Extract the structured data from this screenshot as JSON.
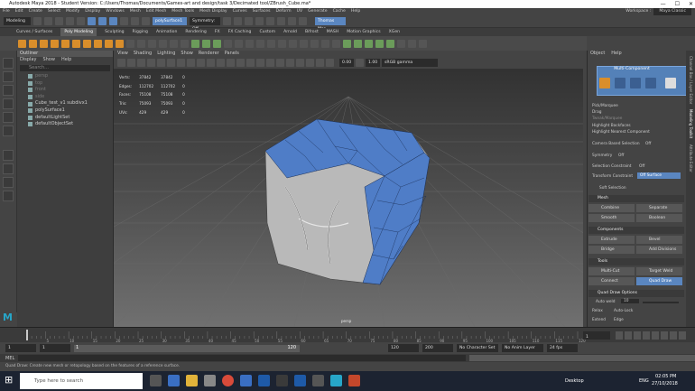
{
  "window": {
    "title": "Autodesk Maya 2018 - Student Version: C:/Users/Thomas/Documents/Games-art and design/task 3/Decimated tool/ZBrush_Cube.ma*",
    "minimize": "—",
    "maximize": "☐",
    "close": "✕"
  },
  "menubar": [
    "File",
    "Edit",
    "Create",
    "Select",
    "Modify",
    "Display",
    "Windows",
    "Mesh",
    "Edit Mesh",
    "Mesh Tools",
    "Mesh Display",
    "Curves",
    "Surfaces",
    "Deform",
    "UV",
    "Generate",
    "Cache",
    "Help"
  ],
  "workspace": {
    "label": "Workspace :",
    "value": "Maya Classic"
  },
  "statusline": {
    "mode": "Modeling",
    "symmetry": "Symmetry: Off",
    "user": "Thomas Mar",
    "object_field": "polySurface1"
  },
  "shelf_tabs": [
    "Curves / Surfaces",
    "Poly Modeling",
    "Sculpting",
    "Rigging",
    "Animation",
    "Rendering",
    "FX",
    "FX Caching",
    "Custom",
    "Arnold",
    "Bifrost",
    "MASH",
    "Motion Graphics",
    "XGen"
  ],
  "shelf_active": "Poly Modeling",
  "outliner": {
    "title": "Outliner",
    "menus": [
      "Display",
      "Show",
      "Help"
    ],
    "search_placeholder": "Search...",
    "items": [
      {
        "label": "persp",
        "dim": true
      },
      {
        "label": "top",
        "dim": true
      },
      {
        "label": "front",
        "dim": true
      },
      {
        "label": "side",
        "dim": true
      },
      {
        "label": "Cube_test_v1 subdivx1",
        "dim": false
      },
      {
        "label": "polySurface1",
        "dim": false
      },
      {
        "label": "defaultLightSet",
        "dim": false
      },
      {
        "label": "defaultObjectSet",
        "dim": false
      }
    ]
  },
  "viewport": {
    "menus": [
      "View",
      "Shading",
      "Lighting",
      "Show",
      "Renderer",
      "Panels"
    ],
    "camera": "persp",
    "gamma": "sRGB gamma",
    "exposure": "0.00",
    "gamma_value": "1.00",
    "hud": [
      {
        "label": "Verts:",
        "a": "37842",
        "b": "37842",
        "c": "0"
      },
      {
        "label": "Edges:",
        "a": "112702",
        "b": "112702",
        "c": "0"
      },
      {
        "label": "Faces:",
        "a": "75108",
        "b": "75108",
        "c": "0"
      },
      {
        "label": "Tris:",
        "a": "75093",
        "b": "75093",
        "c": "0"
      },
      {
        "label": "UVs:",
        "a": "429",
        "b": "429",
        "c": "0"
      }
    ]
  },
  "modeling_toolkit": {
    "menus": [
      "Object",
      "Help"
    ],
    "title": "Multi-Component",
    "pick_marquee": "Pick/Marquee",
    "drag": "Drag",
    "tweak_marquee": "Tweak/Marquee",
    "highlight_backfaces": "Highlight Backfaces",
    "highlight_nearest": "Highlight Nearest Component",
    "camera_based": "Camera Based Selection",
    "camera_based_value": "Off",
    "symmetry": "Symmetry",
    "symmetry_value": "Off",
    "selection_constraint": "Selection Constraint",
    "selection_constraint_value": "Off",
    "transform_constraint": "Transform Constraint",
    "transform_constraint_value": "Off Surface",
    "soft_selection": "Soft Selection",
    "mesh_section": "Mesh",
    "mesh_buttons": [
      "Combine",
      "Separate",
      "Smooth",
      "Boolean"
    ],
    "components_section": "Components",
    "component_buttons": [
      "Extrude",
      "Bevel",
      "Bridge",
      "Add Divisions"
    ],
    "tools_section": "Tools",
    "tool_buttons": [
      "Multi-Cut",
      "Target Weld",
      "Connect",
      "Quad Draw"
    ],
    "active_tool": "Quad Draw",
    "quad_draw_options": "Quad Draw Options",
    "auto_weld": "Auto weld",
    "auto_weld_value": "10",
    "relax": "Relax",
    "relax_value": "Auto-Lock",
    "extend": "Extend",
    "extend_value": "Edge"
  },
  "channel_tabs": [
    "Channel Box / Layer Editor",
    "Modeling Toolkit",
    "Attribute Editor"
  ],
  "timeslider": {
    "ticks": [
      "5",
      "10",
      "15",
      "20",
      "25",
      "30",
      "35",
      "40",
      "45",
      "50",
      "55",
      "60",
      "65",
      "70",
      "75",
      "80",
      "85",
      "90",
      "95",
      "100",
      "105",
      "110",
      "115",
      "120"
    ],
    "current_frame": "1"
  },
  "rangeslider": {
    "start": "1",
    "start_inner": "1",
    "range_marker": "1",
    "end_inner": "120",
    "end_playback": "120",
    "end_anim": "200",
    "character": "No Character Set",
    "anim_layer": "No Anim Layer",
    "fps": "24 fps"
  },
  "mel": {
    "label": "MEL"
  },
  "helpline": "Quad Draw: Create new mesh or retopology based on the features of a reference surface.",
  "taskbar": {
    "search_placeholder": "Type here to search",
    "desktop": "Desktop",
    "lang": "ENG",
    "time": "02:05 PM",
    "date": "27/10/2018"
  },
  "colors": {
    "accent": "#5a86c0",
    "shelf_orange": "#d98e2b",
    "mesh_blue": "#4f7dc7"
  }
}
